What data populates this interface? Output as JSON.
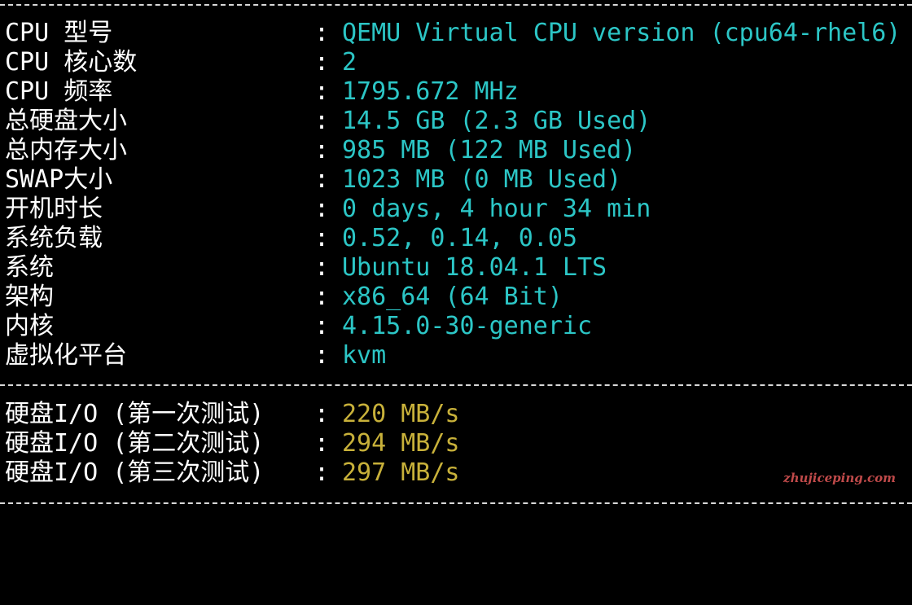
{
  "colors": {
    "background": "#000000",
    "label": "#ffffff",
    "value_info": "#2cc6c6",
    "value_io": "#c8b13a",
    "separator": "#d8d8d8",
    "watermark": "#c04a4a"
  },
  "separator_text": "--------------------------------------------------------------",
  "system_info": [
    {
      "label": "CPU 型号",
      "value": "QEMU Virtual CPU version (cpu64-rhel6)"
    },
    {
      "label": "CPU 核心数",
      "value": "2"
    },
    {
      "label": "CPU 频率",
      "value": "1795.672 MHz"
    },
    {
      "label": "总硬盘大小",
      "value": "14.5 GB (2.3 GB Used)"
    },
    {
      "label": "总内存大小",
      "value": "985 MB (122 MB Used)"
    },
    {
      "label": "SWAP大小",
      "value": "1023 MB (0 MB Used)"
    },
    {
      "label": "开机时长",
      "value": "0 days, 4 hour 34 min"
    },
    {
      "label": "系统负载",
      "value": "0.52, 0.14, 0.05"
    },
    {
      "label": "系统",
      "value": "Ubuntu 18.04.1 LTS"
    },
    {
      "label": "架构",
      "value": "x86_64 (64 Bit)"
    },
    {
      "label": "内核",
      "value": "4.15.0-30-generic"
    },
    {
      "label": "虚拟化平台",
      "value": "kvm"
    }
  ],
  "io_tests": [
    {
      "label": "硬盘I/O (第一次测试)",
      "value": "220 MB/s"
    },
    {
      "label": "硬盘I/O (第二次测试)",
      "value": "294 MB/s"
    },
    {
      "label": "硬盘I/O (第三次测试)",
      "value": "297 MB/s"
    }
  ],
  "colon": ":",
  "watermark": "zhujiceping.com"
}
